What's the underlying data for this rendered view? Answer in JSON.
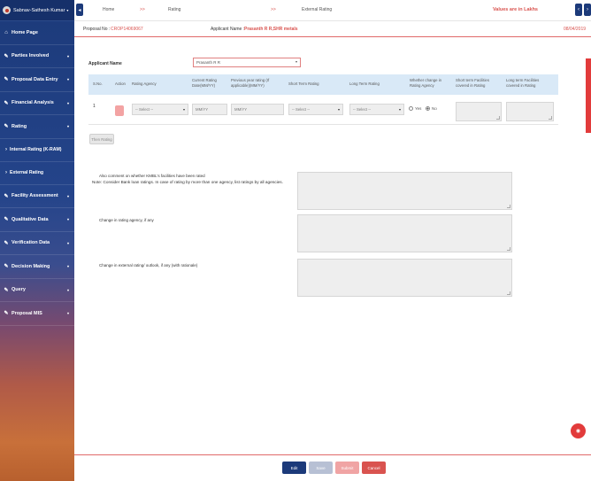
{
  "user": {
    "name": "Sabnav-Sathesh Kumar",
    "caret": "▾"
  },
  "sidebar": {
    "items": [
      {
        "label": "Home Page",
        "icon": "home-icon",
        "glyph": "⌂",
        "arrow": ""
      },
      {
        "label": "Parties Involved",
        "icon": "edit-icon",
        "glyph": "✎",
        "arrow": "▾"
      },
      {
        "label": "Proposal Data Entry",
        "icon": "edit-icon",
        "glyph": "✎",
        "arrow": "▾"
      },
      {
        "label": "Financial Analysis",
        "icon": "edit-icon",
        "glyph": "✎",
        "arrow": "▾"
      },
      {
        "label": "Rating",
        "icon": "edit-icon",
        "glyph": "✎",
        "arrow": "▾"
      }
    ],
    "sub_items": [
      {
        "label": "Internal Rating (K-RAM)",
        "glyph": "›"
      },
      {
        "label": "External Rating",
        "glyph": "›"
      }
    ],
    "items2": [
      {
        "label": "Facility Assessment",
        "icon": "edit-icon",
        "glyph": "✎",
        "arrow": "▾"
      },
      {
        "label": "Qualitative Data",
        "icon": "edit-icon",
        "glyph": "✎",
        "arrow": "▾"
      },
      {
        "label": "Verification Data",
        "icon": "edit-icon",
        "glyph": "✎",
        "arrow": "▾"
      },
      {
        "label": "Decision Making",
        "icon": "edit-icon",
        "glyph": "✎",
        "arrow": "▾"
      },
      {
        "label": "Query",
        "icon": "edit-icon",
        "glyph": "✎",
        "arrow": "▾"
      },
      {
        "label": "Proposal MIS",
        "icon": "edit-icon",
        "glyph": "✎",
        "arrow": "▾"
      }
    ]
  },
  "header": {
    "left_nav": "◂",
    "crumbs": [
      "Home",
      ">>",
      "Rating",
      ">>",
      "External Rating"
    ],
    "values_note": "Values are in Lakhs",
    "prev": "‹",
    "next": "›"
  },
  "proposal": {
    "no_label": "Proposal No :",
    "no_value": "CROP14069067",
    "applicant_label": "Applicant Name :",
    "applicant_value": "Prasanth R R,SHR metals",
    "date": "08/04/2019"
  },
  "form": {
    "applicant_label": "Applicant Name",
    "applicant_selected": "Prasanth R R",
    "columns": [
      "S.No.",
      "Action",
      "Rating Agency",
      "Current Rating Date(MM/YY)",
      "Previous year rating (If applicable)(MM/YY)",
      "Short Term Rating",
      "Long Term Rating",
      "Whether change in Rating Agency",
      "Short term Facilities covered in Rating",
      "Long term Facilities covered in Rating"
    ],
    "row": {
      "sno": "1",
      "agency": "-- Select --",
      "current_date": "MM/YY",
      "previous_date": "MM/YY",
      "short_rating": "-- Select --",
      "long_rating": "-- Select --",
      "radio_yes": "Yes",
      "radio_no": "No"
    },
    "then_button": "Then Rating",
    "note": "Note: Consider Bank loan ratings. In case of rating by more than one agency, list ratings by all agencies.",
    "q1": "Also comment on whether KMBL's facilities have been rated",
    "q2": "Change in rating agency, if any",
    "q3": "Change in external rating/ outlook, if any (with rationale)"
  },
  "footer": {
    "edit": "Edit",
    "save": "Save",
    "submit": "Submit",
    "cancel": "Cancel"
  },
  "colors": {
    "brand_blue": "#1c3a7a",
    "accent_red": "#d9534f",
    "header_blue": "#d9e9f7"
  }
}
